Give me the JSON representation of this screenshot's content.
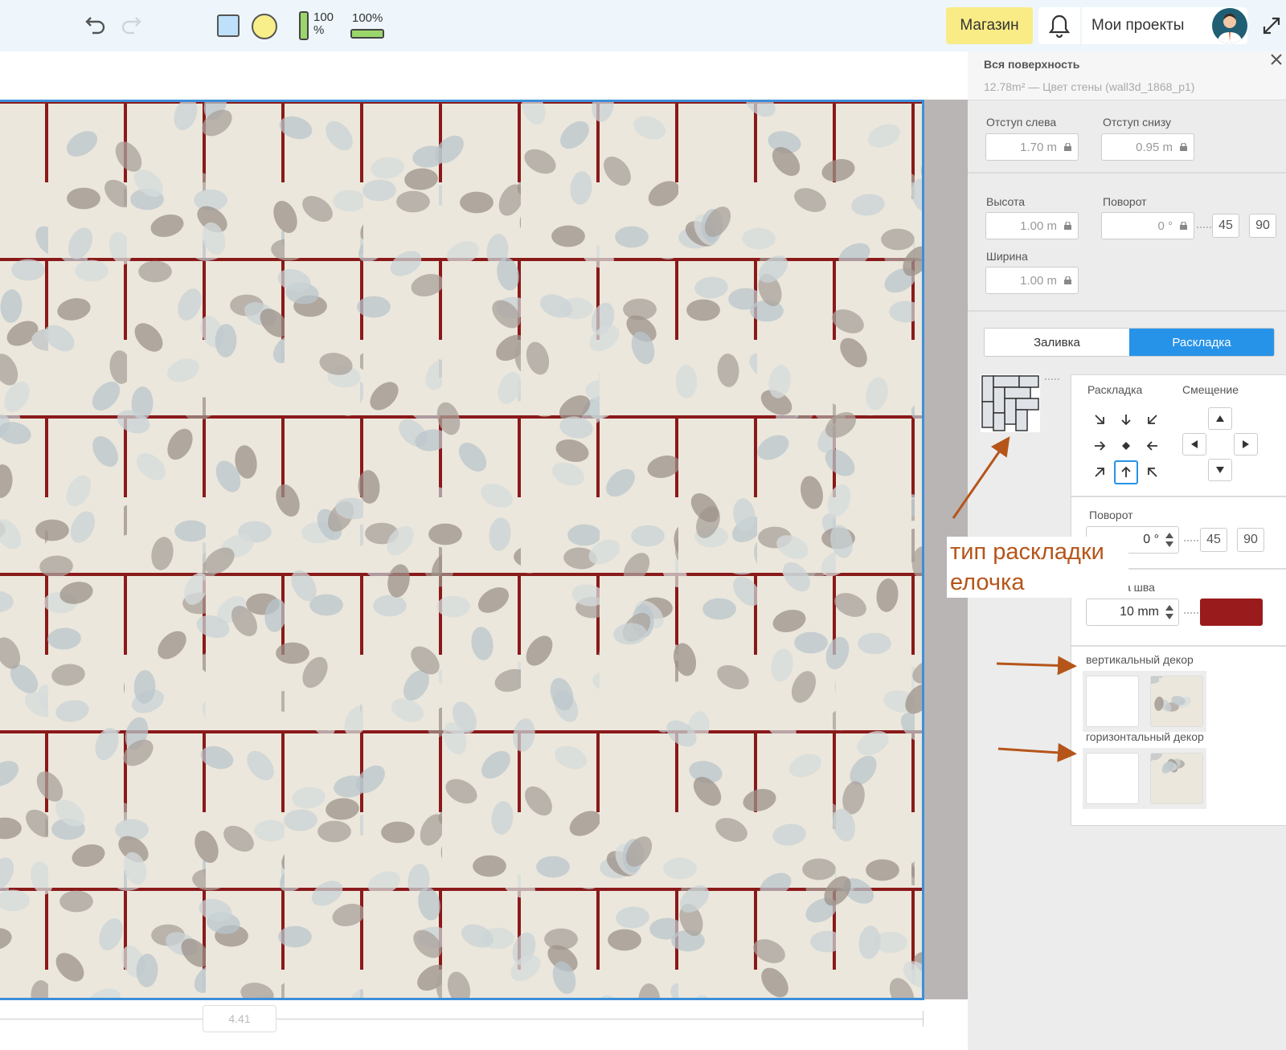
{
  "toolbar": {
    "undo_icon": "undo-icon",
    "redo_icon": "redo-icon",
    "vertical_scale": {
      "label": "100\n%",
      "fill_fraction": 1.0
    },
    "horizontal_scale": {
      "label": "100%",
      "fill_fraction": 1.0
    },
    "shop_label": "Магазин",
    "projects_label": "Мои проекты",
    "colors": {
      "shop_bg": "#f9ec86",
      "rect_fill": "#bfe0fb",
      "circle_fill": "#f8ee8a",
      "scale_fill": "#9ad66a"
    }
  },
  "canvas": {
    "width_label": "4.41",
    "colors": {
      "grout": "#8a1a1a",
      "selection": "#3d8fd9",
      "tile_base": "#ece7dc"
    }
  },
  "panel": {
    "title": "Вся поверхность",
    "subtitle": "12.78m² — Цвет стены (wall3d_1868_p1)",
    "offset_left": {
      "label": "Отступ слева",
      "value": "1.70 m"
    },
    "offset_bottom": {
      "label": "Отступ снизу",
      "value": "0.95 m"
    },
    "height": {
      "label": "Высота",
      "value": "1.00 m"
    },
    "rotation": {
      "label": "Поворот",
      "value": "0 °",
      "quick_45": "45",
      "quick_90": "90"
    },
    "width": {
      "label": "Ширина",
      "value": "1.00 m"
    },
    "tabs": [
      {
        "label": "Заливка",
        "active": false
      },
      {
        "label": "Раскладка",
        "active": true
      }
    ],
    "layout": {
      "label": "Раскладка",
      "offset_label": "Смещение",
      "rotation_label": "Поворот",
      "rotation_value": "0 °",
      "quick_45": "45",
      "quick_90": "90",
      "seam_label": "Ширина шва",
      "seam_value": "10 mm",
      "seam_color": "#9a1b1b",
      "vertical_decor_label": "вертикальный декор",
      "horizontal_decor_label": "горизонтальный декор",
      "selected_anchor": "bottom-center"
    }
  },
  "annotation": {
    "line1": "тип раскладки",
    "line2": "елочка",
    "color": "#b5551a"
  }
}
